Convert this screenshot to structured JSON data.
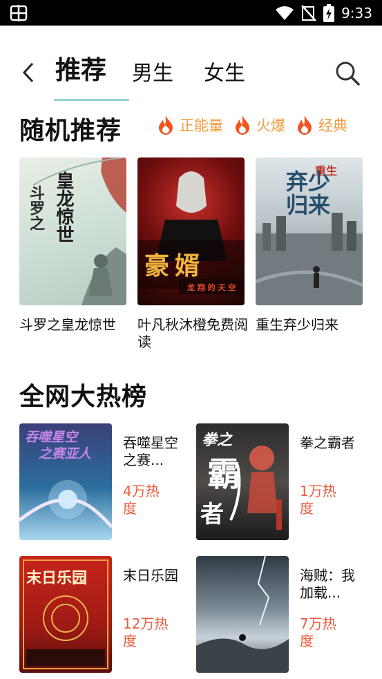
{
  "status_bar": {
    "time": "9:33",
    "icons": [
      "app-badge-icon",
      "wifi-icon",
      "signal-off-icon",
      "battery-charging-icon"
    ]
  },
  "nav": {
    "tabs": [
      {
        "label": "推荐",
        "active": true
      },
      {
        "label": "男生",
        "active": false
      },
      {
        "label": "女生",
        "active": false
      }
    ],
    "icons": {
      "back": "chevron-left-icon",
      "search": "search-icon"
    },
    "accent_color": "#8fd3cc"
  },
  "random_section": {
    "title": "随机推荐",
    "tags": [
      {
        "label": "正能量",
        "icon": "flame-icon"
      },
      {
        "label": "火爆",
        "icon": "flame-icon"
      },
      {
        "label": "经典",
        "icon": "flame-icon"
      }
    ],
    "tag_color": "#f29a3d",
    "books": [
      {
        "title": "斗罗之皇龙惊世",
        "cover_text": "斗罗之皇龙惊世"
      },
      {
        "title": "叶凡秋沐橙免费阅读",
        "cover_text": "豪婿"
      },
      {
        "title": "重生弃少归来",
        "cover_text": "弃少归来"
      }
    ]
  },
  "hot_section": {
    "title": "全网大热榜",
    "heat_color": "#ef5a3c",
    "books": [
      {
        "title": "吞噬星空之赛...",
        "heat": "4万热度",
        "cover_text": "吞噬星空之赛亚人"
      },
      {
        "title": "拳之霸者",
        "heat": "1万热度",
        "cover_text": "拳之霸者"
      },
      {
        "title": "末日乐园",
        "heat": "12万热度",
        "cover_text": "末日乐园"
      },
      {
        "title": "海贼：我加载...",
        "heat": "7万热度",
        "cover_text": ""
      }
    ]
  }
}
